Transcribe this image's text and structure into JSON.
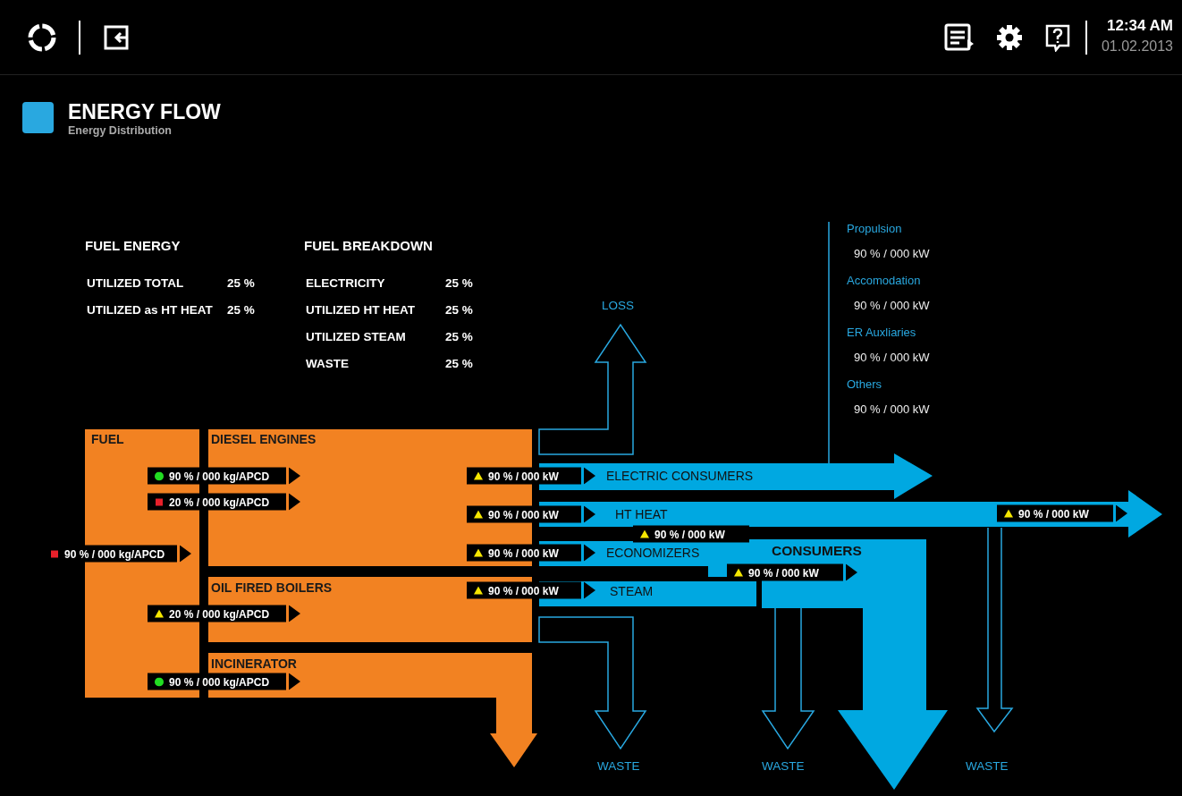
{
  "header": {
    "time": "12:34 AM",
    "date": "01.02.2013"
  },
  "page": {
    "title": "ENERGY FLOW",
    "subtitle": "Energy Distribution"
  },
  "fuel_energy": {
    "title": "FUEL ENERGY",
    "rows": [
      {
        "label": "UTILIZED TOTAL",
        "value": "25 %"
      },
      {
        "label": "UTILIZED as HT HEAT",
        "value": "25 %"
      }
    ]
  },
  "fuel_breakdown": {
    "title": "FUEL BREAKDOWN",
    "rows": [
      {
        "label": "ELECTRICITY",
        "value": "25 %"
      },
      {
        "label": "UTILIZED HT HEAT",
        "value": "25 %"
      },
      {
        "label": "UTILIZED STEAM",
        "value": "25 %"
      },
      {
        "label": "WASTE",
        "value": "25 %"
      }
    ]
  },
  "consumer_breakdown": [
    {
      "label": "Propulsion",
      "reading": "90 %  /  000 kW"
    },
    {
      "label": "Accomodation",
      "reading": "90 %  /  000 kW"
    },
    {
      "label": "ER Auxliaries",
      "reading": "90 %  /  000 kW"
    },
    {
      "label": "Others",
      "reading": "90 %  /  000 kW"
    }
  ],
  "blocks": [
    {
      "label": "FUEL"
    },
    {
      "label": "DIESEL ENGINES"
    },
    {
      "label": "OIL FIRED BOILERS"
    },
    {
      "label": "INCINERATOR"
    }
  ],
  "flows": [
    {
      "label": "ELECTRIC CONSUMERS"
    },
    {
      "label": "HT HEAT"
    },
    {
      "label": "ECONOMIZERS"
    },
    {
      "label": "STEAM"
    },
    {
      "label": "CONSUMERS"
    }
  ],
  "outlets": [
    {
      "label": "LOSS"
    },
    {
      "label": "WASTE"
    },
    {
      "label": "WASTE"
    },
    {
      "label": "WASTE"
    }
  ],
  "readings": [
    {
      "kind": "alarm",
      "text": "90 % / 000 kg/APCD",
      "pointer": true
    },
    {
      "kind": "ok",
      "text": "90 % / 000 kg/APCD",
      "pointer": true
    },
    {
      "kind": "alarm",
      "text": "20 % / 000 kg/APCD",
      "pointer": true
    },
    {
      "kind": "warning",
      "text": "20 % / 000 kg/APCD",
      "pointer": true
    },
    {
      "kind": "ok",
      "text": "90 % / 000 kg/APCD",
      "pointer": true
    },
    {
      "kind": "warning",
      "text": "90 % / 000 kW",
      "pointer": true
    },
    {
      "kind": "warning",
      "text": "90 % / 000 kW",
      "pointer": true
    },
    {
      "kind": "warning",
      "text": "90 % / 000 kW",
      "pointer": true
    },
    {
      "kind": "warning",
      "text": "90 % / 000 kW",
      "pointer": true
    },
    {
      "kind": "warning",
      "text": "90 % / 000 kW",
      "pointer": false
    },
    {
      "kind": "warning",
      "text": "90 % / 000 kW",
      "pointer": true
    },
    {
      "kind": "warning",
      "text": "90 % / 000 kW",
      "pointer": true
    }
  ]
}
